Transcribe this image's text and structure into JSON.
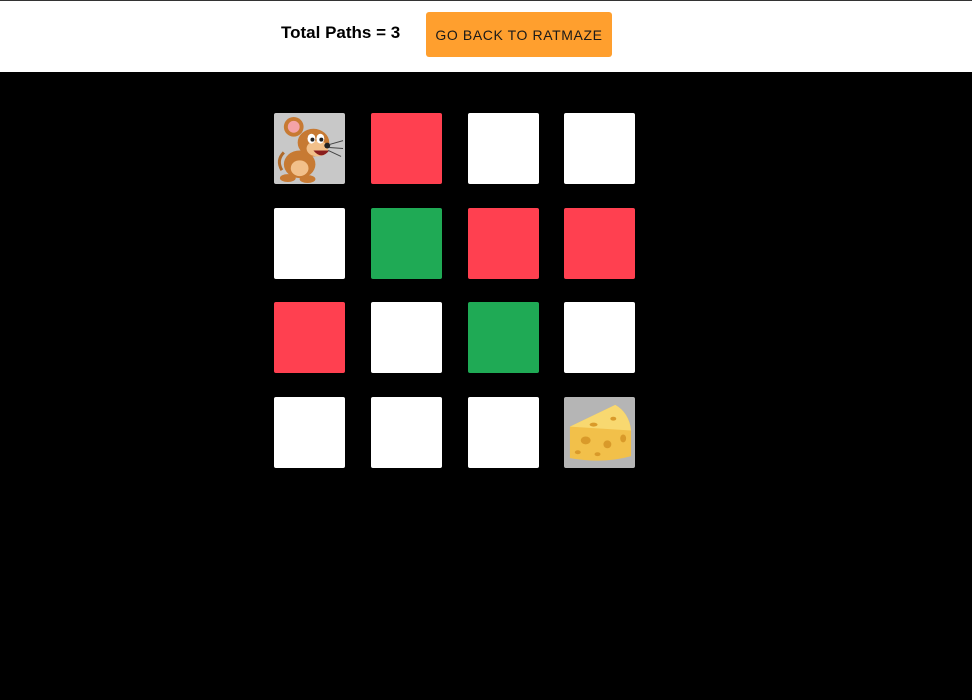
{
  "header": {
    "total_paths_label": "Total Paths = 3",
    "back_button_label": "GO BACK TO RATMAZE"
  },
  "colors": {
    "blocked": "#ff4050",
    "path": "#1faa55",
    "open": "#ffffff",
    "background": "#000000",
    "button": "#ff9f2e"
  },
  "maze": {
    "rows": 4,
    "cols": 4,
    "cells": [
      [
        "rat",
        "blocked",
        "open",
        "open"
      ],
      [
        "open",
        "path",
        "blocked",
        "blocked"
      ],
      [
        "blocked",
        "open",
        "path",
        "open"
      ],
      [
        "open",
        "open",
        "open",
        "cheese"
      ]
    ]
  },
  "icons": {
    "start": "rat-icon",
    "goal": "cheese-icon"
  }
}
